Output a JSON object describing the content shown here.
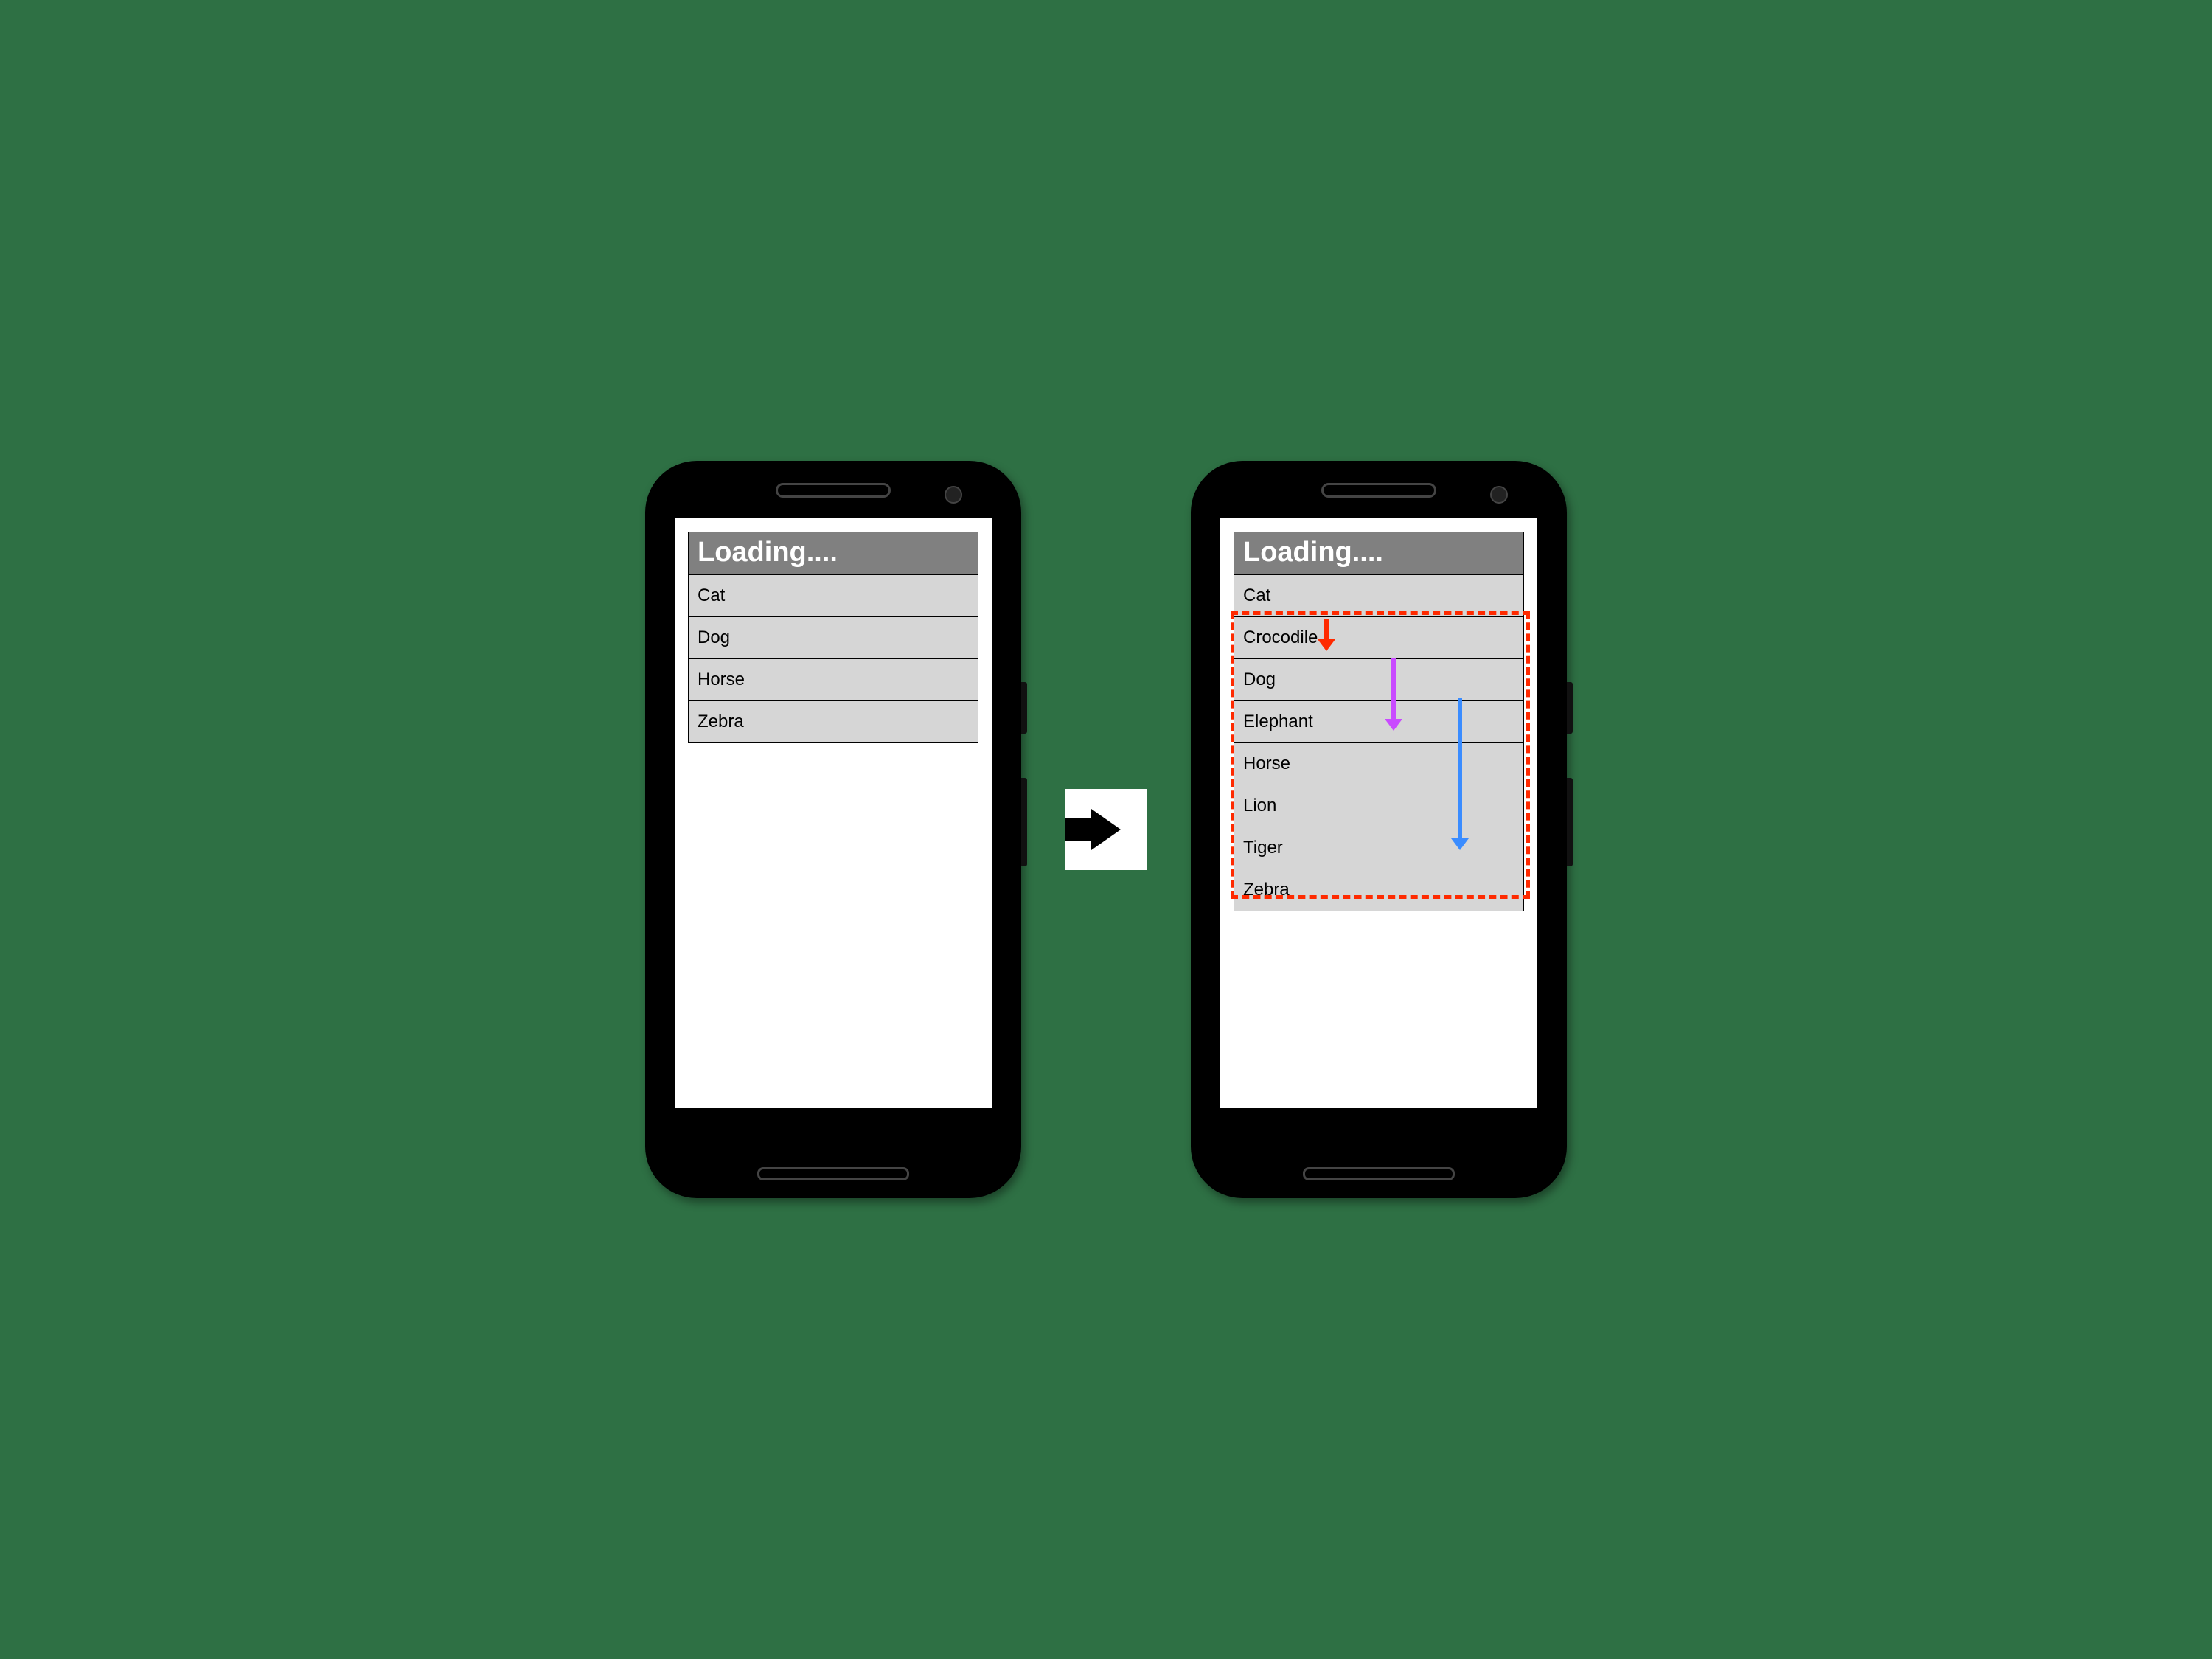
{
  "header_label": "Loading....",
  "left": {
    "items": [
      "Cat",
      "Dog",
      "Horse",
      "Zebra"
    ]
  },
  "right": {
    "items": [
      "Cat",
      "Crocodile",
      "Dog",
      "Elephant",
      "Horse",
      "Lion",
      "Tiger",
      "Zebra"
    ],
    "highlight_range": [
      1,
      7
    ],
    "arrows": [
      {
        "color": "#ff2a00",
        "from_row": 1,
        "to_row": 2,
        "x_pct": 32
      },
      {
        "color": "#c94bff",
        "from_row": 2,
        "to_row": 4,
        "x_pct": 55
      },
      {
        "color": "#3a8cff",
        "from_row": 3,
        "to_row": 7,
        "x_pct": 78
      }
    ]
  }
}
